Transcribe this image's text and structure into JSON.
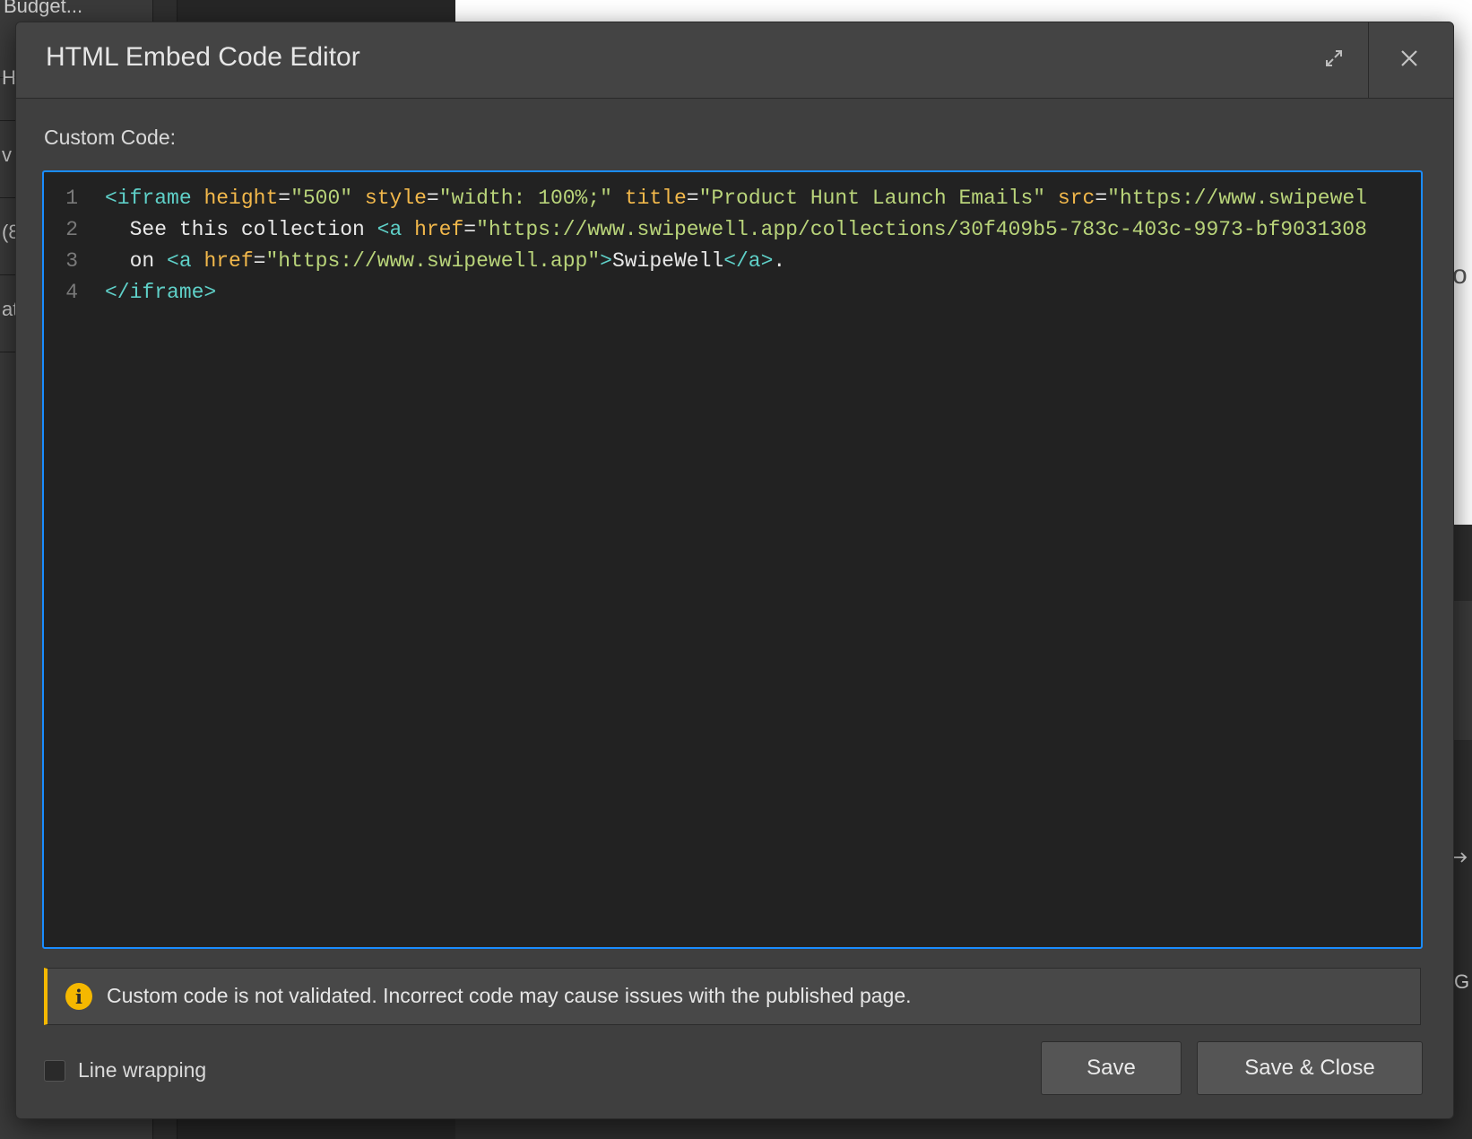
{
  "background": {
    "left_fragments": [
      "Budget...",
      "H",
      "v",
      "(8",
      "at"
    ],
    "right_fragments": [
      "o",
      "G"
    ],
    "right_arrow_icon": "arrow-right-icon"
  },
  "modal": {
    "title": "HTML Embed Code Editor",
    "expand_icon": "expand-icon",
    "close_icon": "close-icon",
    "field_label": "Custom Code:",
    "code_lines": [
      {
        "num": "1",
        "tokens": [
          {
            "t": "tag",
            "v": "<iframe"
          },
          {
            "t": "text",
            "v": " "
          },
          {
            "t": "attr",
            "v": "height"
          },
          {
            "t": "text",
            "v": "="
          },
          {
            "t": "str",
            "v": "\"500\""
          },
          {
            "t": "text",
            "v": " "
          },
          {
            "t": "attr",
            "v": "style"
          },
          {
            "t": "text",
            "v": "="
          },
          {
            "t": "str",
            "v": "\"width: 100%;\""
          },
          {
            "t": "text",
            "v": " "
          },
          {
            "t": "attr",
            "v": "title"
          },
          {
            "t": "text",
            "v": "="
          },
          {
            "t": "str",
            "v": "\"Product Hunt Launch Emails\""
          },
          {
            "t": "text",
            "v": " "
          },
          {
            "t": "attr",
            "v": "src"
          },
          {
            "t": "text",
            "v": "="
          },
          {
            "t": "str",
            "v": "\"https://www.swipewel"
          }
        ]
      },
      {
        "num": "2",
        "tokens": [
          {
            "t": "text",
            "v": "  See this collection "
          },
          {
            "t": "tag",
            "v": "<a"
          },
          {
            "t": "text",
            "v": " "
          },
          {
            "t": "attr",
            "v": "href"
          },
          {
            "t": "text",
            "v": "="
          },
          {
            "t": "str",
            "v": "\"https://www.swipewell.app/collections/30f409b5-783c-403c-9973-bf9031308"
          }
        ]
      },
      {
        "num": "3",
        "tokens": [
          {
            "t": "text",
            "v": "  on "
          },
          {
            "t": "tag",
            "v": "<a"
          },
          {
            "t": "text",
            "v": " "
          },
          {
            "t": "attr",
            "v": "href"
          },
          {
            "t": "text",
            "v": "="
          },
          {
            "t": "str",
            "v": "\"https://www.swipewell.app\""
          },
          {
            "t": "tag",
            "v": ">"
          },
          {
            "t": "text",
            "v": "SwipeWell"
          },
          {
            "t": "tag",
            "v": "</a>"
          },
          {
            "t": "text",
            "v": "."
          }
        ]
      },
      {
        "num": "4",
        "tokens": [
          {
            "t": "tag",
            "v": "</iframe>"
          }
        ]
      }
    ],
    "warning": {
      "icon": "info-icon",
      "icon_glyph": "i",
      "text": "Custom code is not validated. Incorrect code may cause issues with the published page."
    },
    "line_wrapping": {
      "label": "Line wrapping",
      "checked": false
    },
    "buttons": {
      "save": "Save",
      "save_close": "Save & Close"
    }
  },
  "colors": {
    "accent_border": "#1a8cff",
    "warning": "#f5b800",
    "code_tag": "#5fd0c8",
    "code_attr": "#f2b84b",
    "code_string": "#b9d47a"
  }
}
